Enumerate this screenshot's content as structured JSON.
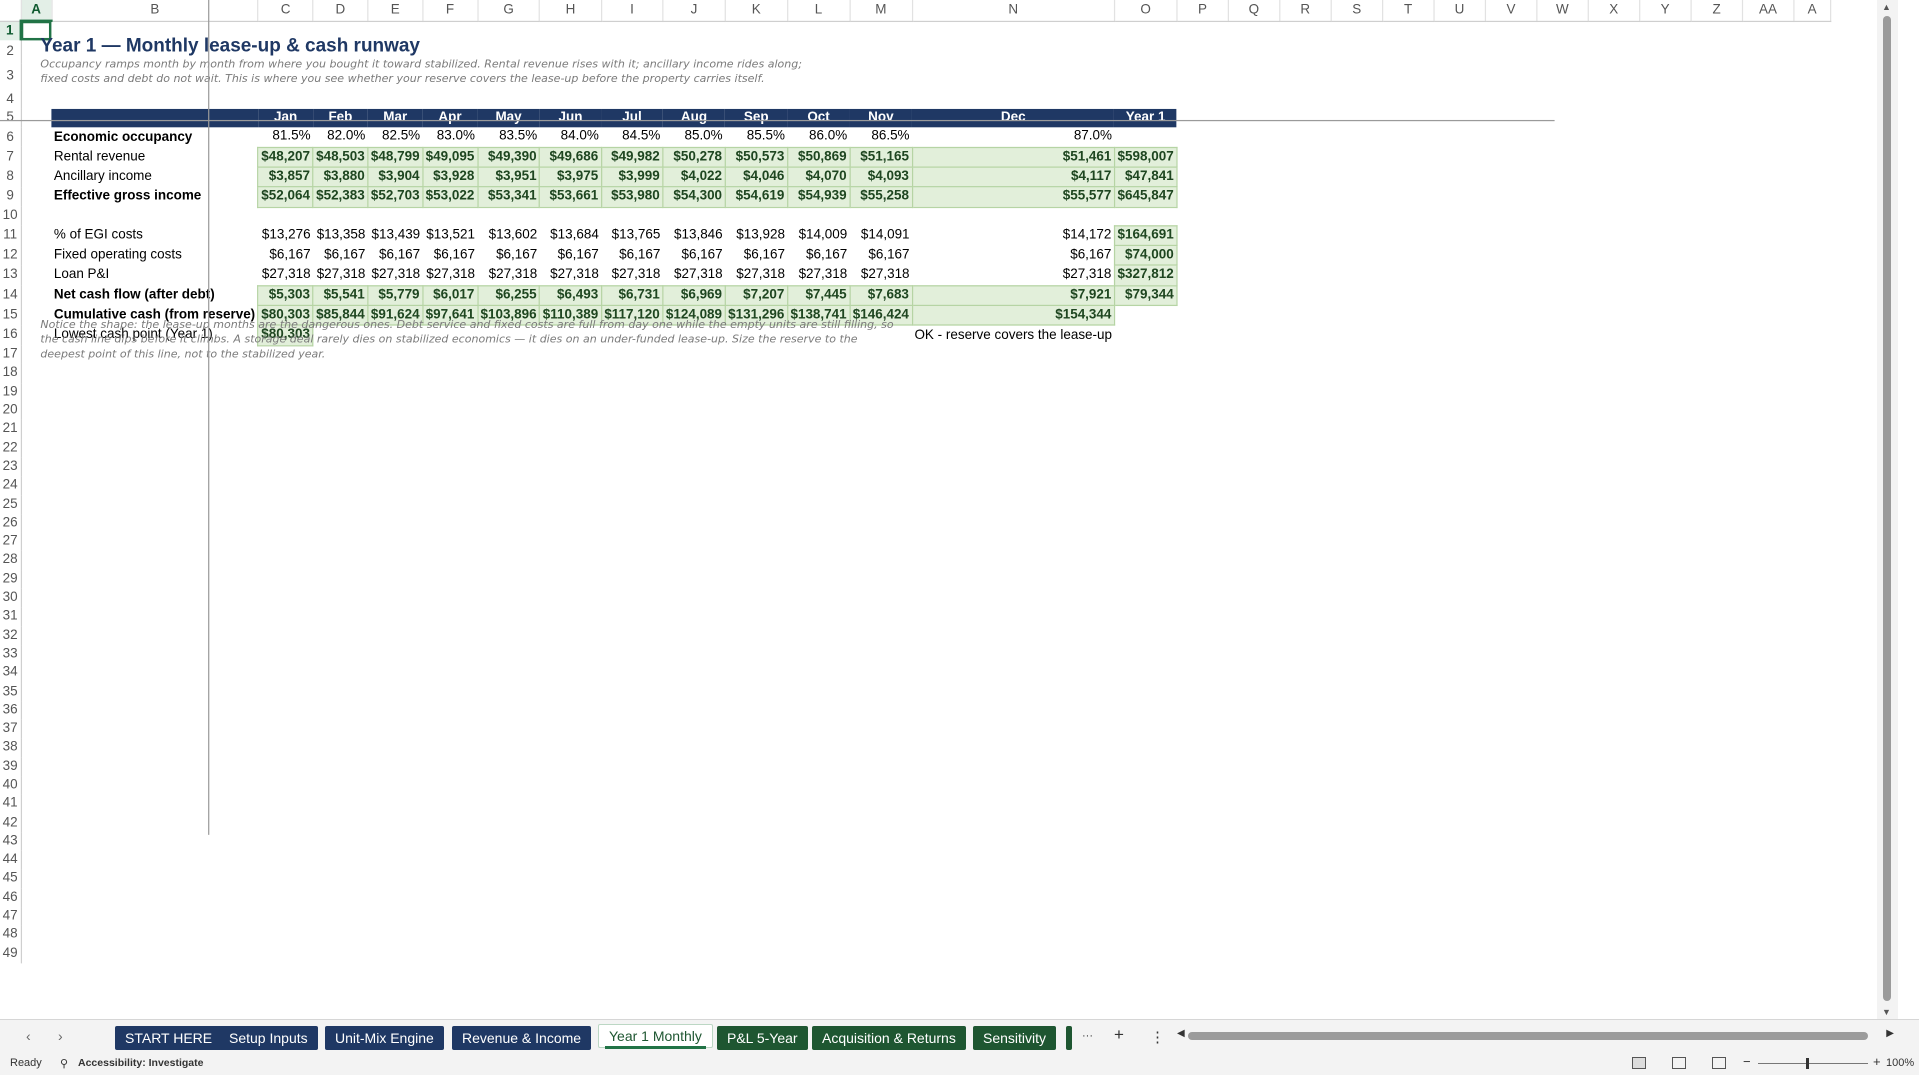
{
  "app": "Excel",
  "sheet": {
    "columns": [
      "A",
      "B",
      "C",
      "D",
      "E",
      "F",
      "G",
      "H",
      "I",
      "J",
      "K",
      "L",
      "M",
      "N",
      "O",
      "P",
      "Q",
      "R",
      "S",
      "T",
      "U",
      "V",
      "W",
      "X",
      "Y",
      "Z",
      "AA",
      "A"
    ],
    "selected_cell": "A1",
    "title": "Year 1 — Monthly lease-up & cash runway",
    "description": "Occupancy ramps month by month from where you bought it toward stabilized. Rental revenue rises with it; ancillary income rides along; fixed costs and debt do not wait. This is where you see whether your reserve covers the lease-up before the property carries itself.",
    "header_row": [
      "Jan",
      "Feb",
      "Mar",
      "Apr",
      "May",
      "Jun",
      "Jul",
      "Aug",
      "Sep",
      "Oct",
      "Nov",
      "Dec",
      "Year 1"
    ],
    "rows": [
      {
        "label": "Economic occupancy",
        "values": [
          "81.5%",
          "82.0%",
          "82.5%",
          "83.0%",
          "83.5%",
          "84.0%",
          "84.5%",
          "85.0%",
          "85.5%",
          "86.0%",
          "86.5%",
          "87.0%",
          ""
        ]
      },
      {
        "label": "Rental revenue",
        "values": [
          "$48,207",
          "$48,503",
          "$48,799",
          "$49,095",
          "$49,390",
          "$49,686",
          "$49,982",
          "$50,278",
          "$50,573",
          "$50,869",
          "$51,165",
          "$51,461",
          "$598,007"
        ]
      },
      {
        "label": "Ancillary income",
        "values": [
          "$3,857",
          "$3,880",
          "$3,904",
          "$3,928",
          "$3,951",
          "$3,975",
          "$3,999",
          "$4,022",
          "$4,046",
          "$4,070",
          "$4,093",
          "$4,117",
          "$47,841"
        ]
      },
      {
        "label": "Effective gross income",
        "values": [
          "$52,064",
          "$52,383",
          "$52,703",
          "$53,022",
          "$53,341",
          "$53,661",
          "$53,980",
          "$54,300",
          "$54,619",
          "$54,939",
          "$55,258",
          "$55,577",
          "$645,847"
        ]
      },
      {
        "label": "% of EGI costs",
        "values": [
          "$13,276",
          "$13,358",
          "$13,439",
          "$13,521",
          "$13,602",
          "$13,684",
          "$13,765",
          "$13,846",
          "$13,928",
          "$14,009",
          "$14,091",
          "$14,172",
          "$164,691"
        ]
      },
      {
        "label": "Fixed operating costs",
        "values": [
          "$6,167",
          "$6,167",
          "$6,167",
          "$6,167",
          "$6,167",
          "$6,167",
          "$6,167",
          "$6,167",
          "$6,167",
          "$6,167",
          "$6,167",
          "$6,167",
          "$74,000"
        ]
      },
      {
        "label": "Loan P&I",
        "values": [
          "$27,318",
          "$27,318",
          "$27,318",
          "$27,318",
          "$27,318",
          "$27,318",
          "$27,318",
          "$27,318",
          "$27,318",
          "$27,318",
          "$27,318",
          "$27,318",
          "$327,812"
        ]
      },
      {
        "label": "Net cash flow (after debt)",
        "values": [
          "$5,303",
          "$5,541",
          "$5,779",
          "$6,017",
          "$6,255",
          "$6,493",
          "$6,731",
          "$6,969",
          "$7,207",
          "$7,445",
          "$7,683",
          "$7,921",
          "$79,344"
        ]
      },
      {
        "label": "Cumulative cash (from reserve)",
        "values": [
          "$80,303",
          "$85,844",
          "$91,624",
          "$97,641",
          "$103,896",
          "$110,389",
          "$117,120",
          "$124,089",
          "$131,296",
          "$138,741",
          "$146,424",
          "$154,344",
          ""
        ]
      }
    ],
    "lowest_label": "Lowest cash point (Year 1)",
    "lowest_value": "$80,303",
    "status_text": "OK - reserve covers the lease-up",
    "footnote": "Notice the shape: the lease-up months are the dangerous ones. Debt service and fixed costs are full from day one while the empty units are still filling, so the cash line dips before it climbs. A storage deal rarely dies on stabilized economics — it dies on an under-funded lease-up. Size the reserve to the deepest point of this line, not to the stabilized year."
  },
  "tabs": [
    {
      "label": "START HERE",
      "style": "navy"
    },
    {
      "label": "Setup Inputs",
      "style": "navy"
    },
    {
      "label": "Unit-Mix Engine",
      "style": "navy"
    },
    {
      "label": "Revenue & Income",
      "style": "navy"
    },
    {
      "label": "Year 1 Monthly",
      "style": "active"
    },
    {
      "label": "P&L 5-Year",
      "style": "dark"
    },
    {
      "label": "Acquisition & Returns",
      "style": "dark"
    },
    {
      "label": "Sensitivity",
      "style": "dark"
    }
  ],
  "tab_more": "···",
  "tab_add": "+",
  "tab_options": "⋮",
  "status": {
    "ready": "Ready",
    "accessibility": "Accessibility: Investigate",
    "zoom": "100%"
  }
}
